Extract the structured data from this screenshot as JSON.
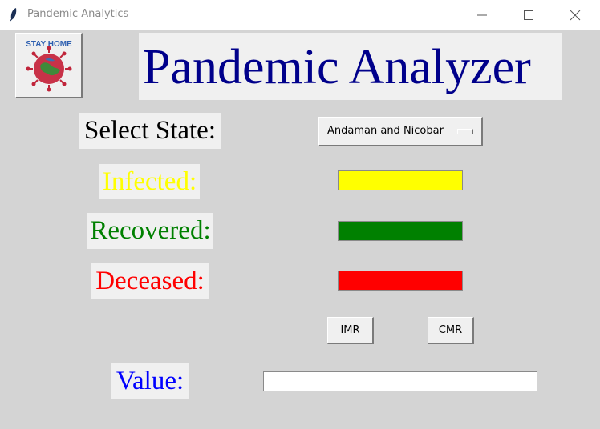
{
  "window": {
    "title": "Pandemic Analytics",
    "icon": "feather-icon"
  },
  "logo": {
    "icon": "stay-home-virus-icon",
    "text": "STAY HOME"
  },
  "banner": {
    "title": "Pandemic Analyzer",
    "color": "#00008b"
  },
  "labels": {
    "select_state": "Select State:",
    "infected": "Infected:",
    "recovered": "Recovered:",
    "deceased": "Deceased:",
    "value": "Value:"
  },
  "state_menu": {
    "selected": "Andaman and Nicobar"
  },
  "bars": {
    "infected": {
      "color": "#ffff00",
      "fill": 1.0
    },
    "recovered": {
      "color": "#008000",
      "fill": 1.0
    },
    "deceased": {
      "color": "#ff0000",
      "fill": 1.0
    }
  },
  "buttons": {
    "imr": "IMR",
    "cmr": "CMR"
  },
  "value_field": {
    "value": ""
  }
}
